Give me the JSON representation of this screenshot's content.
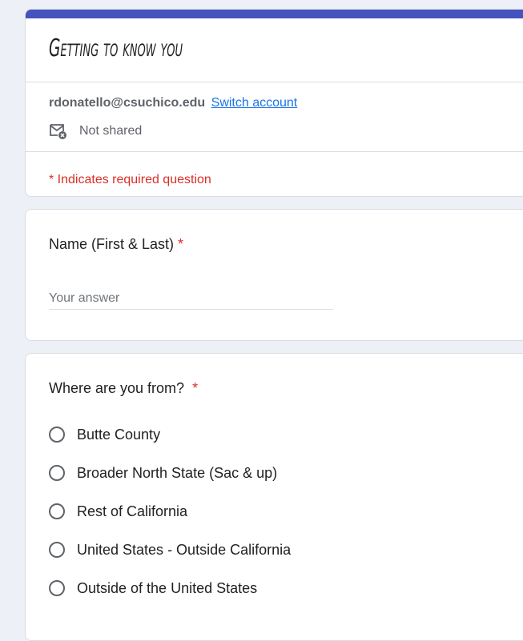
{
  "form": {
    "title": "Getting to know you",
    "accent_color": "#4453bd",
    "account_email": "rdonatello@csuchico.edu",
    "switch_account_label": "Switch account",
    "shared_status": "Not shared",
    "required_note": "* Indicates required question"
  },
  "questions": [
    {
      "title": "Name (First & Last)",
      "required_marker": "*",
      "answer_placeholder": "Your answer",
      "answer_value": ""
    },
    {
      "title": "Where are you from?",
      "required_marker": "*",
      "options": [
        "Butte County",
        "Broader North State (Sac & up)",
        "Rest of California",
        "United States - Outside California",
        "Outside of the United States"
      ]
    }
  ]
}
